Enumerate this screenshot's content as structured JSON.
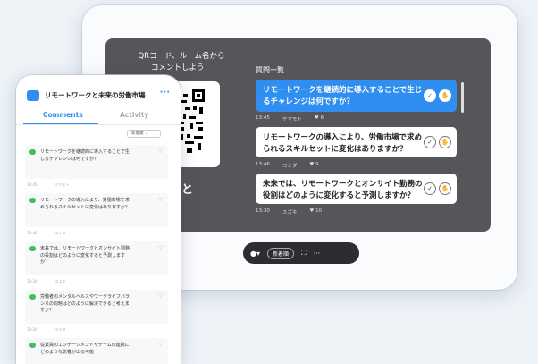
{
  "tablet": {
    "qr_title": "QRコード、ルーム名から\nコメントしよう！",
    "room_name": "ワークと\n市場",
    "questions_header": "質問一覧",
    "questions": [
      {
        "text": "リモートワークを継続的に導入することで生じるチャレンジは何ですか？",
        "time": "13:45",
        "author": "ヤマモト",
        "likes": "6",
        "active": true
      },
      {
        "text": "リモートワークの導入により、労働市場で求められるスキルセットに変化はありますか？",
        "time": "13:46",
        "author": "ヨシダ",
        "likes": "9",
        "active": false
      },
      {
        "text": "未来では、リモートワークとオンサイト勤務の役割はどのように変化すると予測しますか？",
        "time": "13:30",
        "author": "スズキ",
        "likes": "10",
        "active": false
      }
    ],
    "toolbar": {
      "sort_label": "新着順"
    }
  },
  "phone": {
    "title": "リモートワークと未来の労働市場",
    "tabs": [
      "Comments",
      "Activity"
    ],
    "sort_label": "新着順",
    "comments": [
      {
        "text": "リモートワークを継続的に導入することで生じるチャレンジは何ですか？",
        "time": "13:45",
        "author": "ヤマモト"
      },
      {
        "text": "リモートワークの導入により、労働市場で求められるスキルセットに変化はありますか？",
        "time": "13:46",
        "author": "ヨシダ"
      },
      {
        "text": "未来では、リモートワークとオンサイト勤務の役割はどのように変化すると予測しますか？",
        "time": "13:30",
        "author": "スズキ"
      },
      {
        "text": "労働者のメンタルヘルスやワークライフバランスの問題はどのように解決できると考えますか？",
        "time": "13:20",
        "author": "マツダ"
      },
      {
        "text": "従業員のエンゲージメントやチームの連携にどのような影響が出る可能",
        "time": "",
        "author": ""
      }
    ]
  },
  "colors": {
    "accent": "#2f8ef0",
    "screen_bg": "#555659",
    "bubble": "#3fbf5e"
  }
}
